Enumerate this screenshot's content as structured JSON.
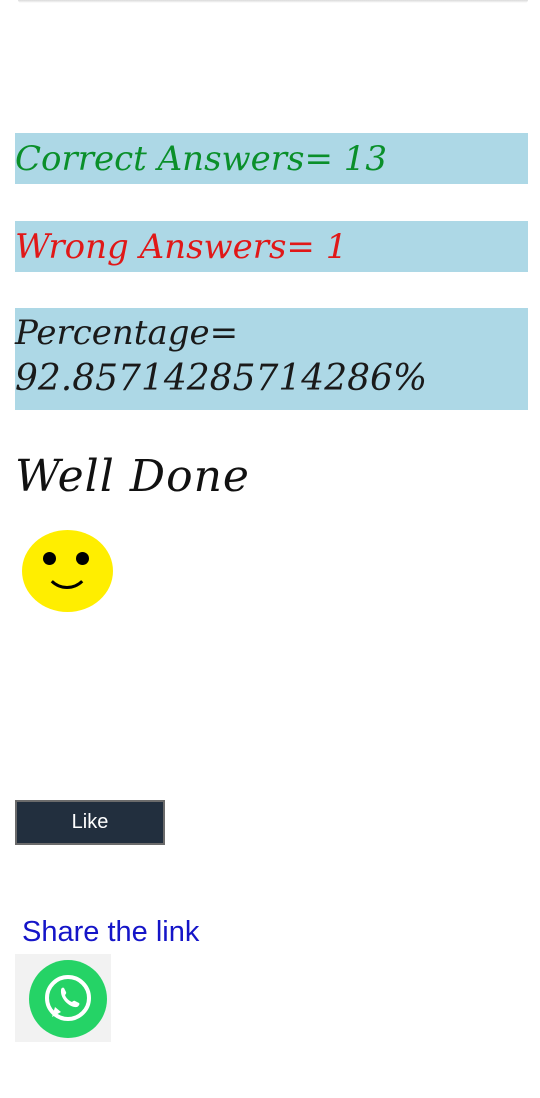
{
  "results": {
    "correct_text": "Correct Answers= 13",
    "wrong_text": "Wrong Answers= 1",
    "percentage_label": "Percentage=",
    "percentage_value": "92.85714285714286%"
  },
  "message": "Well Done",
  "like_button_label": "Like",
  "share": {
    "link_text": "Share the link",
    "icon": "whatsapp-icon"
  },
  "colors": {
    "box_background": "#add8e6",
    "correct": "#0a8f2a",
    "wrong": "#e01818",
    "link": "#1515c8",
    "button": "#222f3e",
    "smiley": "#ffee00",
    "whatsapp": "#25d366"
  }
}
